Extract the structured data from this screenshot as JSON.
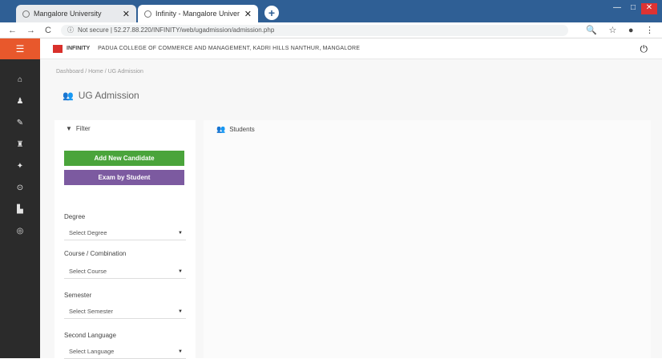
{
  "browser": {
    "tabs": [
      {
        "label": "Mangalore University",
        "close": "✕"
      },
      {
        "label": "Infinity - Mangalore University",
        "close": "✕"
      }
    ],
    "new_tab": "+",
    "url": "Not secure | 52.27.88.220/INFINITY/web/ugadmission/admission.php",
    "url_secure_label": "ⓘ"
  },
  "app": {
    "brand": "INFINITY",
    "college": "PADUA COLLEGE OF COMMERCE AND MANAGEMENT, KADRI HILLS NANTHUR, MANGALORE",
    "breadcrumb": "Dashboard / Home / UG Admission",
    "page_title": "UG Admission"
  },
  "filter": {
    "title": "Filter",
    "add_button": "Add New Candidate",
    "exam_button": "Exam by Student",
    "degree": {
      "label": "Degree",
      "value": "Select Degree"
    },
    "course": {
      "label": "Course / Combination",
      "value": "Select Course"
    },
    "semester": {
      "label": "Semester",
      "value": "Select Semester"
    },
    "language": {
      "label": "Second Language",
      "value": "Select Language"
    }
  },
  "students": {
    "title": "Students"
  },
  "colors": {
    "accent_orange": "#e8582c",
    "green": "#4aa43b",
    "purple": "#7c5aa0",
    "sidebar": "#2b2b2b"
  }
}
